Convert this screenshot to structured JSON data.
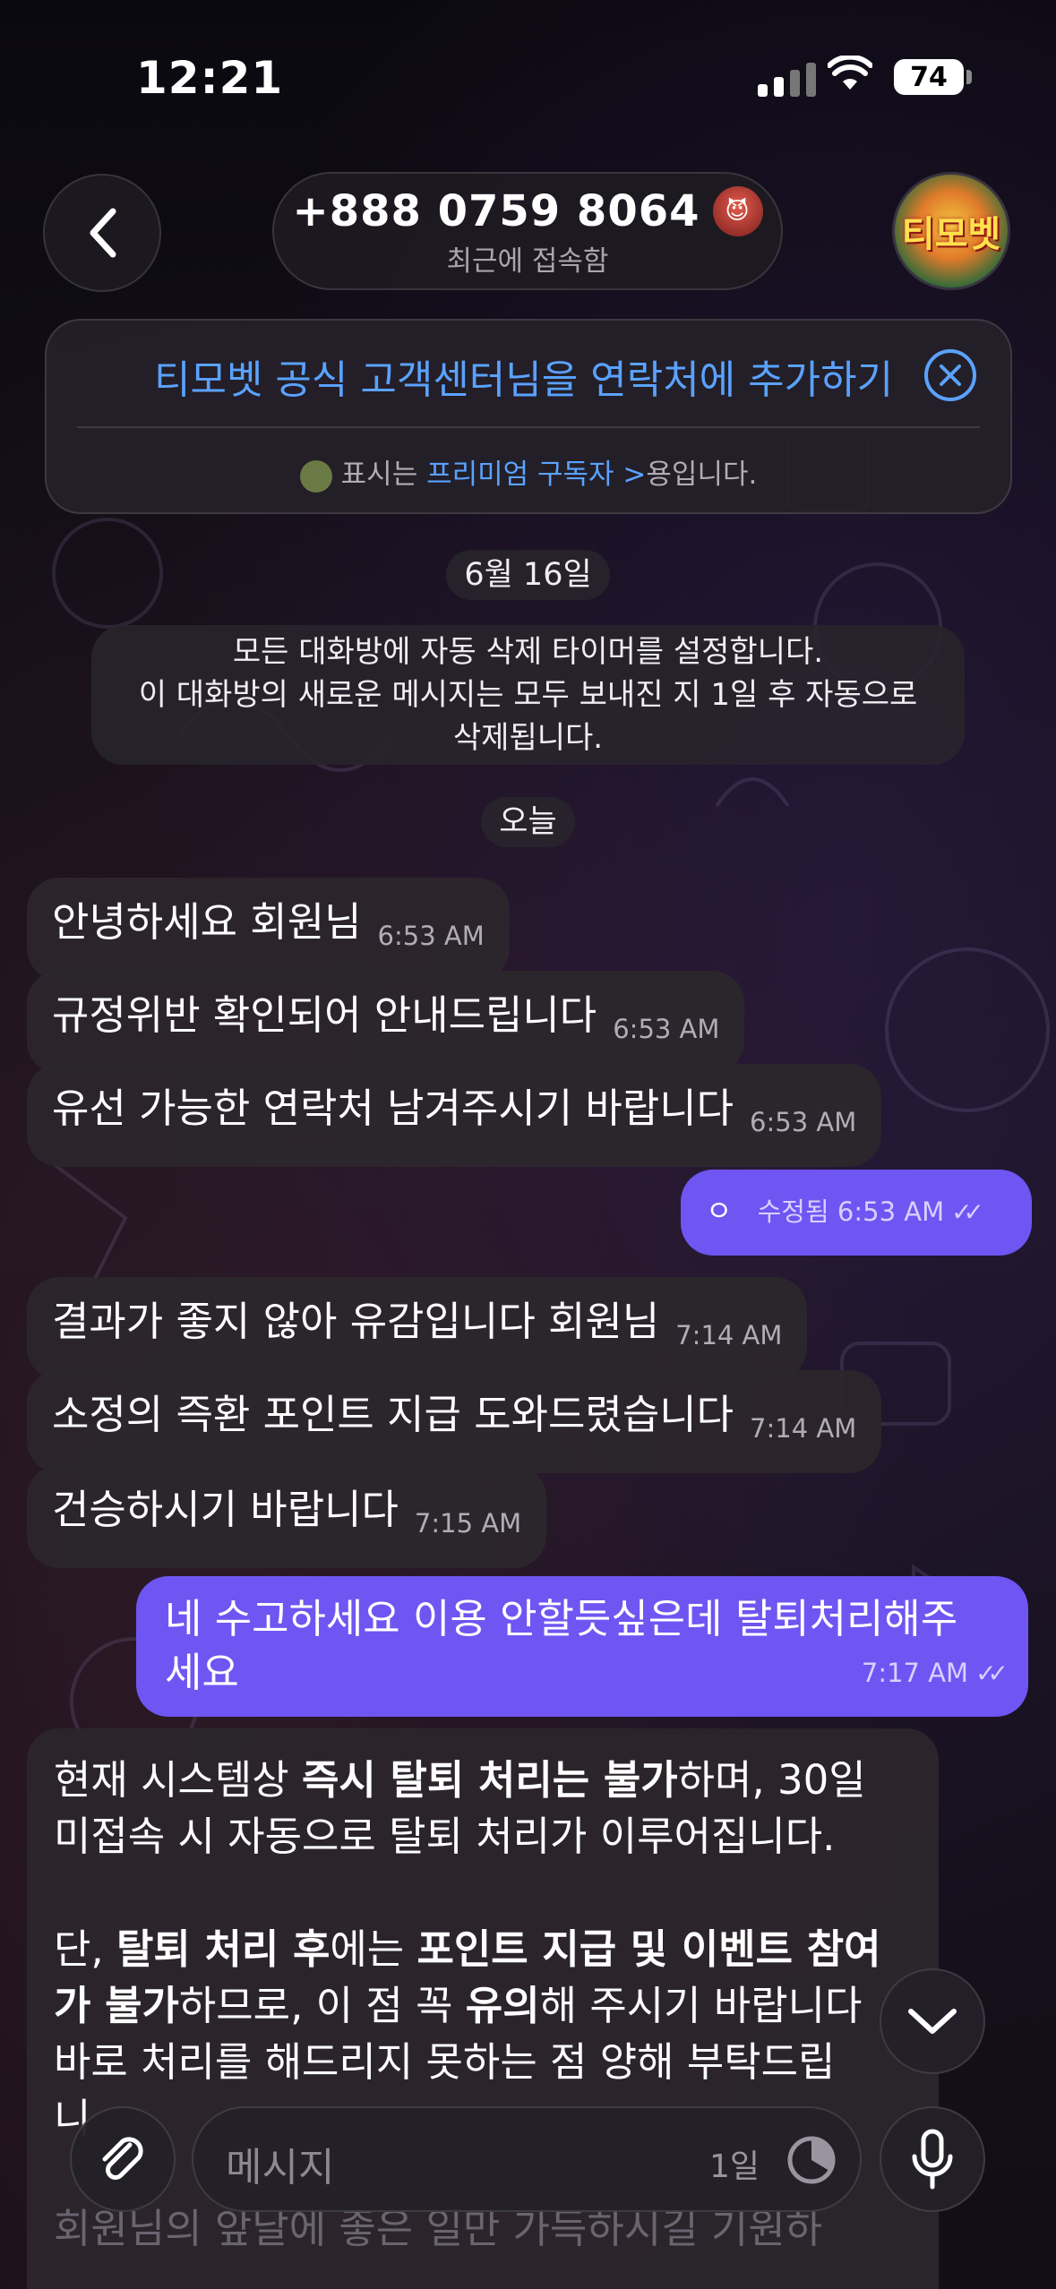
{
  "status_bar": {
    "time": "12:21",
    "battery": "74"
  },
  "header": {
    "name": "+888 0759 8064",
    "name_emoji": "😈",
    "status": "최근에 접속함",
    "avatar_label": "티모벳"
  },
  "add_contact": {
    "link": "티모벳 공식 고객센터님을 연락처에 추가하기",
    "premium_prefix": "표시는",
    "premium_link": "프리미엄 구독자 >",
    "premium_suffix": "용입니다."
  },
  "service": {
    "date1": "6월 16일",
    "notice_line1": "모든 대화방에 자동 삭제 타이머를 설정합니다.",
    "notice_line2": "이 대화방의 새로운 메시지는 모두 보내진 지 1일 후 자동으로",
    "notice_line3": "삭제됩니다.",
    "date2": "오늘"
  },
  "messages": [
    {
      "dir": "in",
      "text": "안녕하세요 회원님",
      "time": "6:53 AM"
    },
    {
      "dir": "in",
      "text": "규정위반 확인되어 안내드립니다",
      "time": "6:53 AM"
    },
    {
      "dir": "in",
      "text": "유선 가능한 연락처 남겨주시기 바랍니다",
      "time": "6:53 AM"
    },
    {
      "dir": "out",
      "text": "ㅇ",
      "edited": "수정됨",
      "time": "6:53 AM"
    },
    {
      "dir": "in",
      "text": "결과가 좋지 않아 유감입니다 회원님",
      "time": "7:14 AM"
    },
    {
      "dir": "in",
      "text": "소정의 즉환 포인트 지급 도와드렸습니다",
      "time": "7:14 AM"
    },
    {
      "dir": "in",
      "text": "건승하시기 바랍니다",
      "time": "7:15 AM"
    },
    {
      "dir": "out",
      "text_line1": "네 수고하세요 이용 안할듯싶은데 탈퇴처리해주",
      "text_line2": "세요",
      "time": "7:17 AM"
    }
  ],
  "long_message": {
    "l1_a": "현재 시스템상 ",
    "l1_b": "즉시 탈퇴 처리는 불가",
    "l1_c": "하며, 30일",
    "l2": "미접속 시 자동으로 탈퇴 처리가 이루어집니다.",
    "l3_a": "단, ",
    "l3_b": "탈퇴 처리 후",
    "l3_c": "에는 ",
    "l3_d": "포인트 지급 및 이벤트 참여",
    "l4_a": "가 불가",
    "l4_b": "하므로, 이 점 꼭 ",
    "l4_c": "유의",
    "l4_d": "해 주시기 바랍니다",
    "l5": "바로 처리를 해드리지 못하는 점 양해 부탁드립",
    "l6": "니",
    "l7": "회원님의 앞날에 좋은 일만 가득하시길 기원하"
  },
  "composer": {
    "placeholder": "메시지",
    "timer": "1일"
  },
  "colors": {
    "accent_blue": "#5aa2ff",
    "outgoing_bubble": "#6f55f2",
    "incoming_bubble": "#2c262c"
  },
  "icons": [
    "back-chevron-icon",
    "close-circle-icon",
    "paperclip-icon",
    "timer-icon",
    "microphone-icon",
    "chevron-down-icon",
    "double-check-icon"
  ]
}
